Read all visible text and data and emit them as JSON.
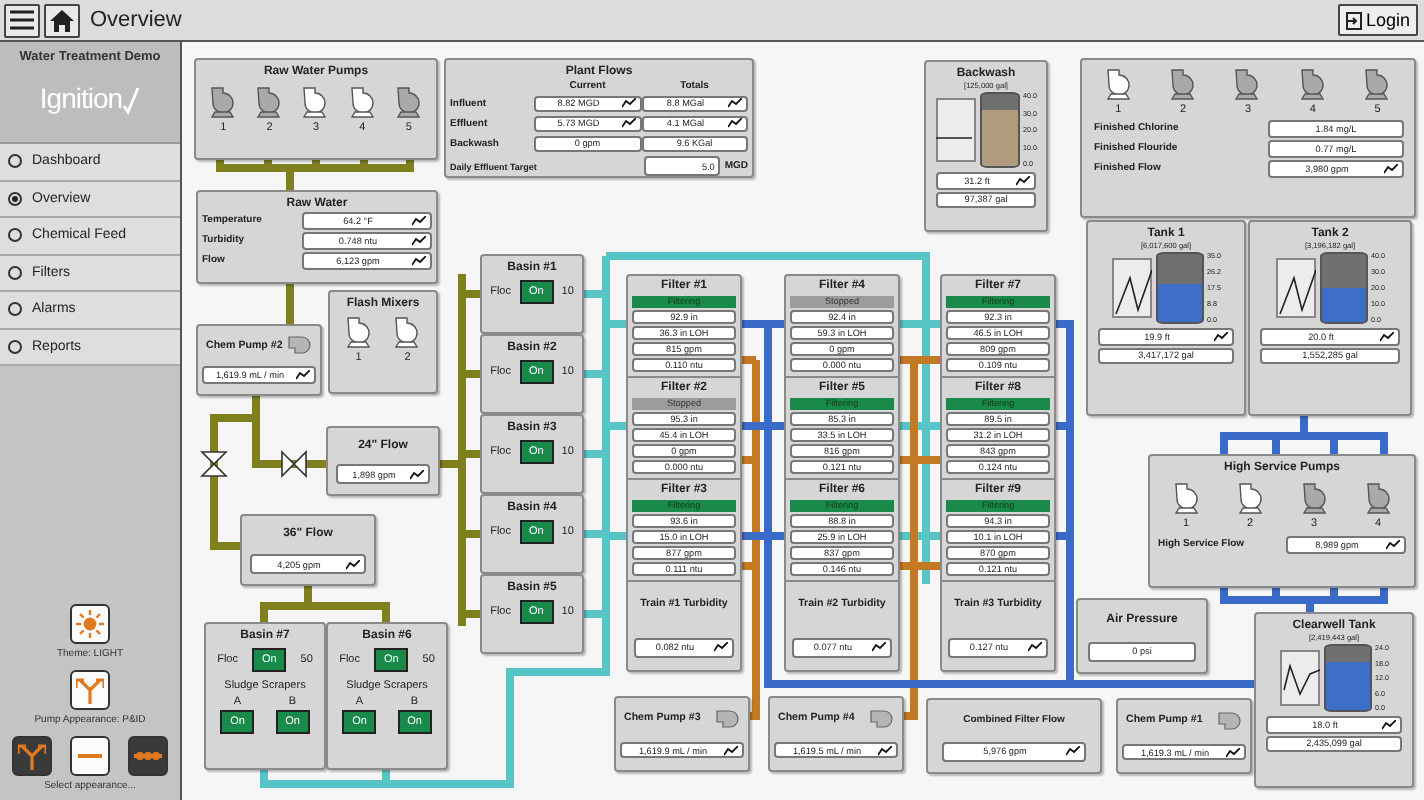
{
  "header": {
    "title": "Overview",
    "login": "Login"
  },
  "sidebar": {
    "title": "Water Treatment Demo",
    "logo": "Ignition",
    "nav": [
      {
        "label": "Dashboard",
        "selected": false
      },
      {
        "label": "Overview",
        "selected": true
      },
      {
        "label": "Chemical Feed",
        "selected": false
      },
      {
        "label": "Filters",
        "selected": false
      },
      {
        "label": "Alarms",
        "selected": false
      },
      {
        "label": "Reports",
        "selected": false
      }
    ],
    "theme": {
      "label": "Theme: LIGHT"
    },
    "pump_appearance": {
      "label": "Pump Appearance: P&ID"
    },
    "appearance_options": [
      {
        "kind": "fork",
        "selected": false
      },
      {
        "kind": "dash",
        "selected": true
      },
      {
        "kind": "chain",
        "selected": false
      }
    ],
    "appearance_hint": "Select appearance..."
  },
  "raw_water_pumps": {
    "title": "Raw Water Pumps",
    "pumps": [
      {
        "label": "1",
        "running": false
      },
      {
        "label": "2",
        "running": false
      },
      {
        "label": "3",
        "running": true
      },
      {
        "label": "4",
        "running": true
      },
      {
        "label": "5",
        "running": false
      }
    ]
  },
  "raw_water": {
    "title": "Raw Water",
    "rows": [
      {
        "label": "Temperature",
        "value": "64.2 °F",
        "trend": true
      },
      {
        "label": "Turbidity",
        "value": "0.748 ntu",
        "trend": true
      },
      {
        "label": "Flow",
        "value": "6,123 gpm",
        "trend": true
      }
    ]
  },
  "flash_mixers": {
    "title": "Flash Mixers",
    "mixers": [
      {
        "label": "1",
        "running": true
      },
      {
        "label": "2",
        "running": true
      }
    ]
  },
  "plant_flows": {
    "title": "Plant Flows",
    "columns": [
      "Current",
      "Totals"
    ],
    "rows": [
      {
        "label": "Influent",
        "current": {
          "value": "8.82 MGD",
          "trend": true
        },
        "total": {
          "value": "8.8 MGal",
          "trend": true
        }
      },
      {
        "label": "Effluent",
        "current": {
          "value": "5.73 MGD",
          "trend": true
        },
        "total": {
          "value": "4.1 MGal",
          "trend": true
        }
      },
      {
        "label": "Backwash",
        "current": {
          "value": "0 gpm",
          "trend": false
        },
        "total": {
          "value": "9.6 KGal",
          "trend": false
        }
      }
    ],
    "target": {
      "label": "Daily Effluent Target",
      "value": "5.0",
      "unit": "MGD"
    }
  },
  "backwash": {
    "title": "Backwash",
    "capacity": "[125,000 gal]",
    "level": 0.78,
    "ticks": [
      "40.0",
      "30.0",
      "20.0",
      "10.0",
      "0.0"
    ],
    "readings": [
      {
        "value": "31.2 ft",
        "trend": true
      },
      {
        "value": "97,387 gal",
        "trend": false
      }
    ]
  },
  "finished_water": {
    "pumps": [
      {
        "label": "1",
        "running": true
      },
      {
        "label": "2",
        "running": false
      },
      {
        "label": "3",
        "running": false
      },
      {
        "label": "4",
        "running": false
      },
      {
        "label": "5",
        "running": false
      }
    ],
    "rows": [
      {
        "label": "Finished Chlorine",
        "value": "1.84 mg/L",
        "trend": false
      },
      {
        "label": "Finished Flouride",
        "value": "0.77 mg/L",
        "trend": false
      },
      {
        "label": "Finished Flow",
        "value": "3,980 gpm",
        "trend": true
      }
    ]
  },
  "tanks": [
    {
      "title": "Tank 1",
      "capacity": "[6,017,600 gal]",
      "level": 0.57,
      "ticks": [
        "35.0",
        "26.2",
        "17.5",
        "8.8",
        "0.0"
      ],
      "readings": [
        {
          "value": "19.9 ft",
          "trend": true
        },
        {
          "value": "3,417,172 gal",
          "trend": false
        }
      ]
    },
    {
      "title": "Tank 2",
      "capacity": "[3,196,182 gal]",
      "level": 0.5,
      "ticks": [
        "40.0",
        "30.0",
        "20.0",
        "10.0",
        "0.0"
      ],
      "readings": [
        {
          "value": "20.0 ft",
          "trend": true
        },
        {
          "value": "1,552,285 gal",
          "trend": false
        }
      ]
    }
  ],
  "flow_meters": [
    {
      "title": "24\" Flow",
      "value": "1,898 gpm",
      "trend": true
    },
    {
      "title": "36\" Flow",
      "value": "4,205 gpm",
      "trend": true
    }
  ],
  "basins": [
    {
      "title": "Basin #1",
      "floc_label": "Floc",
      "floc_on": true,
      "floc_button": "On",
      "floc_value": "10"
    },
    {
      "title": "Basin #2",
      "floc_label": "Floc",
      "floc_on": true,
      "floc_button": "On",
      "floc_value": "10"
    },
    {
      "title": "Basin #3",
      "floc_label": "Floc",
      "floc_on": true,
      "floc_button": "On",
      "floc_value": "10"
    },
    {
      "title": "Basin #4",
      "floc_label": "Floc",
      "floc_on": true,
      "floc_button": "On",
      "floc_value": "10"
    },
    {
      "title": "Basin #5",
      "floc_label": "Floc",
      "floc_on": true,
      "floc_button": "On",
      "floc_value": "10"
    }
  ],
  "filter_trains": [
    {
      "filters": [
        {
          "title": "Filter #1",
          "status": "Filtering",
          "filtering": true,
          "values": [
            "92.9 in",
            "36.3 in LOH",
            "815 gpm",
            "0.110 ntu"
          ]
        },
        {
          "title": "Filter #2",
          "status": "Stopped",
          "filtering": false,
          "values": [
            "95.3 in",
            "45.4 in LOH",
            "0 gpm",
            "0.000 ntu"
          ]
        },
        {
          "title": "Filter #3",
          "status": "Filtering",
          "filtering": true,
          "values": [
            "93.6 in",
            "15.0 in LOH",
            "877 gpm",
            "0.111 ntu"
          ]
        }
      ],
      "turbidity": {
        "title": "Train #1 Turbidity",
        "value": "0.082 ntu",
        "trend": true
      }
    },
    {
      "filters": [
        {
          "title": "Filter #4",
          "status": "Stopped",
          "filtering": false,
          "values": [
            "92.4 in",
            "59.3 in LOH",
            "0 gpm",
            "0.000 ntu"
          ]
        },
        {
          "title": "Filter #5",
          "status": "Filtering",
          "filtering": true,
          "values": [
            "85.3 in",
            "33.5 in LOH",
            "816 gpm",
            "0.121 ntu"
          ]
        },
        {
          "title": "Filter #6",
          "status": "Filtering",
          "filtering": true,
          "values": [
            "88.8 in",
            "25.9 in LOH",
            "837 gpm",
            "0.146 ntu"
          ]
        }
      ],
      "turbidity": {
        "title": "Train #2 Turbidity",
        "value": "0.077 ntu",
        "trend": true
      }
    },
    {
      "filters": [
        {
          "title": "Filter #7",
          "status": "Filtering",
          "filtering": true,
          "values": [
            "92.3 in",
            "46.5 in LOH",
            "809 gpm",
            "0.109 ntu"
          ]
        },
        {
          "title": "Filter #8",
          "status": "Filtering",
          "filtering": true,
          "values": [
            "89.5 in",
            "31.2 in LOH",
            "843 gpm",
            "0.124 ntu"
          ]
        },
        {
          "title": "Filter #9",
          "status": "Filtering",
          "filtering": true,
          "values": [
            "94.3 in",
            "10.1 in LOH",
            "870 gpm",
            "0.121 ntu"
          ]
        }
      ],
      "turbidity": {
        "title": "Train #3 Turbidity",
        "value": "0.127 ntu",
        "trend": true
      }
    }
  ],
  "sludge_basins": [
    {
      "title": "Basin #7",
      "floc_label": "Floc",
      "floc_on": true,
      "floc_button": "On",
      "floc_value": "50",
      "scrapers_title": "Sludge Scrapers",
      "scrapers": [
        {
          "label": "A",
          "on": true,
          "button": "On"
        },
        {
          "label": "B",
          "on": true,
          "button": "On"
        }
      ]
    },
    {
      "title": "Basin #6",
      "floc_label": "Floc",
      "floc_on": true,
      "floc_button": "On",
      "floc_value": "50",
      "scrapers_title": "Sludge Scrapers",
      "scrapers": [
        {
          "label": "A",
          "on": true,
          "button": "On"
        },
        {
          "label": "B",
          "on": true,
          "button": "On"
        }
      ]
    }
  ],
  "chem_pumps": [
    {
      "title": "Chem Pump #2",
      "value": "1,619.9 mL / min",
      "trend": true
    },
    {
      "title": "Chem Pump #3",
      "value": "1,619.9 mL / min",
      "trend": true
    },
    {
      "title": "Chem Pump #4",
      "value": "1,619.5 mL / min",
      "trend": true
    },
    {
      "title": "Chem Pump #1",
      "value": "1,619.3 mL / min",
      "trend": true
    }
  ],
  "combined_filter_flow": {
    "title": "Combined Filter Flow",
    "value": "5,976 gpm",
    "trend": true
  },
  "air_pressure": {
    "title": "Air Pressure",
    "value": "0 psi",
    "trend": false
  },
  "high_service_pumps": {
    "title": "High Service Pumps",
    "pumps": [
      {
        "label": "1",
        "running": true
      },
      {
        "label": "2",
        "running": true
      },
      {
        "label": "3",
        "running": false
      },
      {
        "label": "4",
        "running": false
      }
    ],
    "flow_label": "High Service Flow",
    "flow": {
      "value": "8,989 gpm",
      "trend": true
    }
  },
  "clearwell": {
    "title": "Clearwell Tank",
    "capacity": "[2,419,443 gal]",
    "level": 0.75,
    "ticks": [
      "24.0",
      "18.0",
      "12.0",
      "6.0",
      "0.0"
    ],
    "readings": [
      {
        "value": "18.0 ft",
        "trend": true
      },
      {
        "value": "2,435,099 gal",
        "trend": false
      }
    ]
  }
}
